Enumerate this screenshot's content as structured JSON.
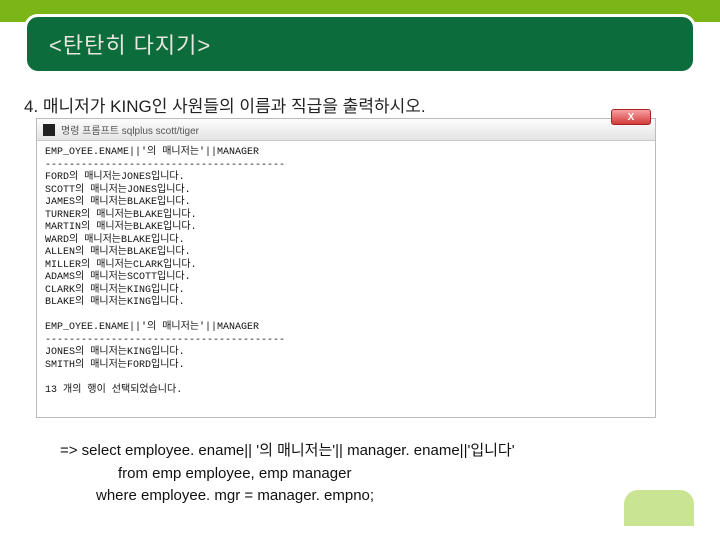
{
  "header": {
    "title": "<탄탄히 다지기>"
  },
  "question": {
    "text": "4. 매니저가 KING인 사원들의 이름과 직급을 출력하시오."
  },
  "terminal": {
    "title": "명령 프롬프트  sqlplus scott/tiger",
    "close_label": "X",
    "lines": [
      "EMP_OYEE.ENAME||'의 매니저는'||MANAGER",
      "----------------------------------------",
      "FORD의 매니저는JONES입니다.",
      "SCOTT의 매니저는JONES입니다.",
      "JAMES의 매니저는BLAKE입니다.",
      "TURNER의 매니저는BLAKE입니다.",
      "MARTIN의 매니저는BLAKE입니다.",
      "WARD의 매니저는BLAKE입니다.",
      "ALLEN의 매니저는BLAKE입니다.",
      "MILLER의 매니저는CLARK입니다.",
      "ADAMS의 매니저는SCOTT입니다.",
      "CLARK의 매니저는KING입니다.",
      "BLAKE의 매니저는KING입니다.",
      "",
      "EMP_OYEE.ENAME||'의 매니저는'||MANAGER",
      "----------------------------------------",
      "JONES의 매니저는KING입니다.",
      "SMITH의 매니저는FORD입니다.",
      "",
      "13 개의 행이 선택되었습니다."
    ]
  },
  "answer": {
    "line1": "=> select employee. ename|| '의 매니저는'|| manager. ename||'입니다'",
    "line2": "from emp employee, emp manager",
    "line3": "where employee. mgr = manager. empno;"
  }
}
